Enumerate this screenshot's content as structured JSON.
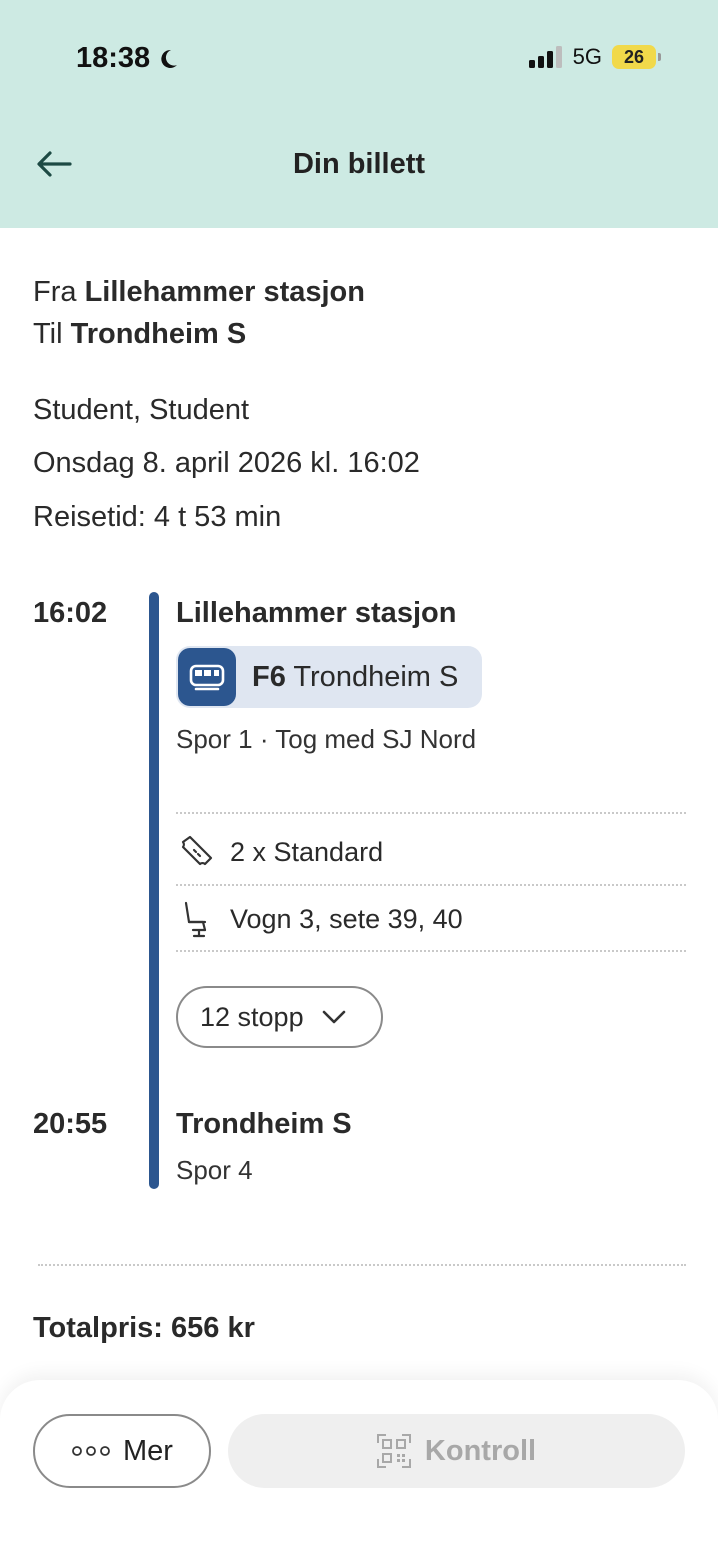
{
  "status_bar": {
    "time": "18:38",
    "network": "5G",
    "battery": "26"
  },
  "header": {
    "title": "Din billett"
  },
  "route": {
    "from_label": "Fra",
    "from_station": "Lillehammer stasjon",
    "to_label": "Til",
    "to_station": "Trondheim S"
  },
  "details": {
    "passengers": "Student, Student",
    "date": "Onsdag 8. april 2026 kl. 16:02",
    "travel_time": "Reisetid: 4 t 53 min"
  },
  "departure": {
    "time": "16:02",
    "station": "Lillehammer stasjon",
    "line_code": "F6",
    "line_destination": "Trondheim S",
    "platform_info": "Spor 1 · Tog med SJ Nord"
  },
  "features": {
    "ticket": "2 x Standard",
    "seat": "Vogn 3, sete 39, 40"
  },
  "stops_button": "12 stopp",
  "arrival": {
    "time": "20:55",
    "station": "Trondheim S",
    "platform": "Spor 4"
  },
  "total_price": "Totalpris: 656 kr",
  "actions": {
    "more": "Mer",
    "control": "Kontroll"
  },
  "colors": {
    "header_bg": "#cdeae3",
    "accent": "#2c568f",
    "chip_bg": "#dfe6f1",
    "battery": "#f1d94a"
  }
}
